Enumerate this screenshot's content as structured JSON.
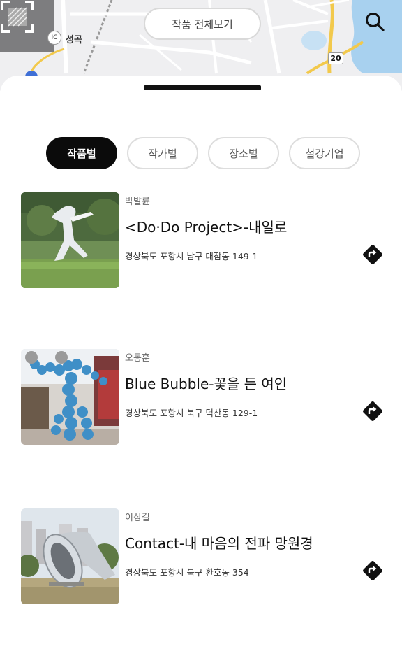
{
  "map": {
    "view_all_label": "작품 전체보기",
    "place_label": "성곡",
    "ic_label": "IC",
    "route_number": "20",
    "colors": {
      "water": "#a8d1ef",
      "road": "#ffffff",
      "highway": "#f2c94c",
      "land": "#efeff1"
    }
  },
  "tabs": [
    {
      "label": "작품별",
      "active": true
    },
    {
      "label": "작가별",
      "active": false
    },
    {
      "label": "장소별",
      "active": false
    },
    {
      "label": "철강기업",
      "active": false
    }
  ],
  "artworks": [
    {
      "artist": "박발륜",
      "title": "<Do·Do Project>-내일로",
      "address": "경상북도 포항시 남구 대잠동 149-1",
      "icon": "directions-icon"
    },
    {
      "artist": "오동훈",
      "title": "Blue Bubble-꽃을 든 여인",
      "address": "경상북도 포항시 북구 덕산동 129-1",
      "icon": "directions-icon"
    },
    {
      "artist": "이상길",
      "title": "Contact-내 마음의 전파 망원경",
      "address": "경상북도 포항시 북구 환호동 354",
      "icon": "directions-icon"
    }
  ]
}
